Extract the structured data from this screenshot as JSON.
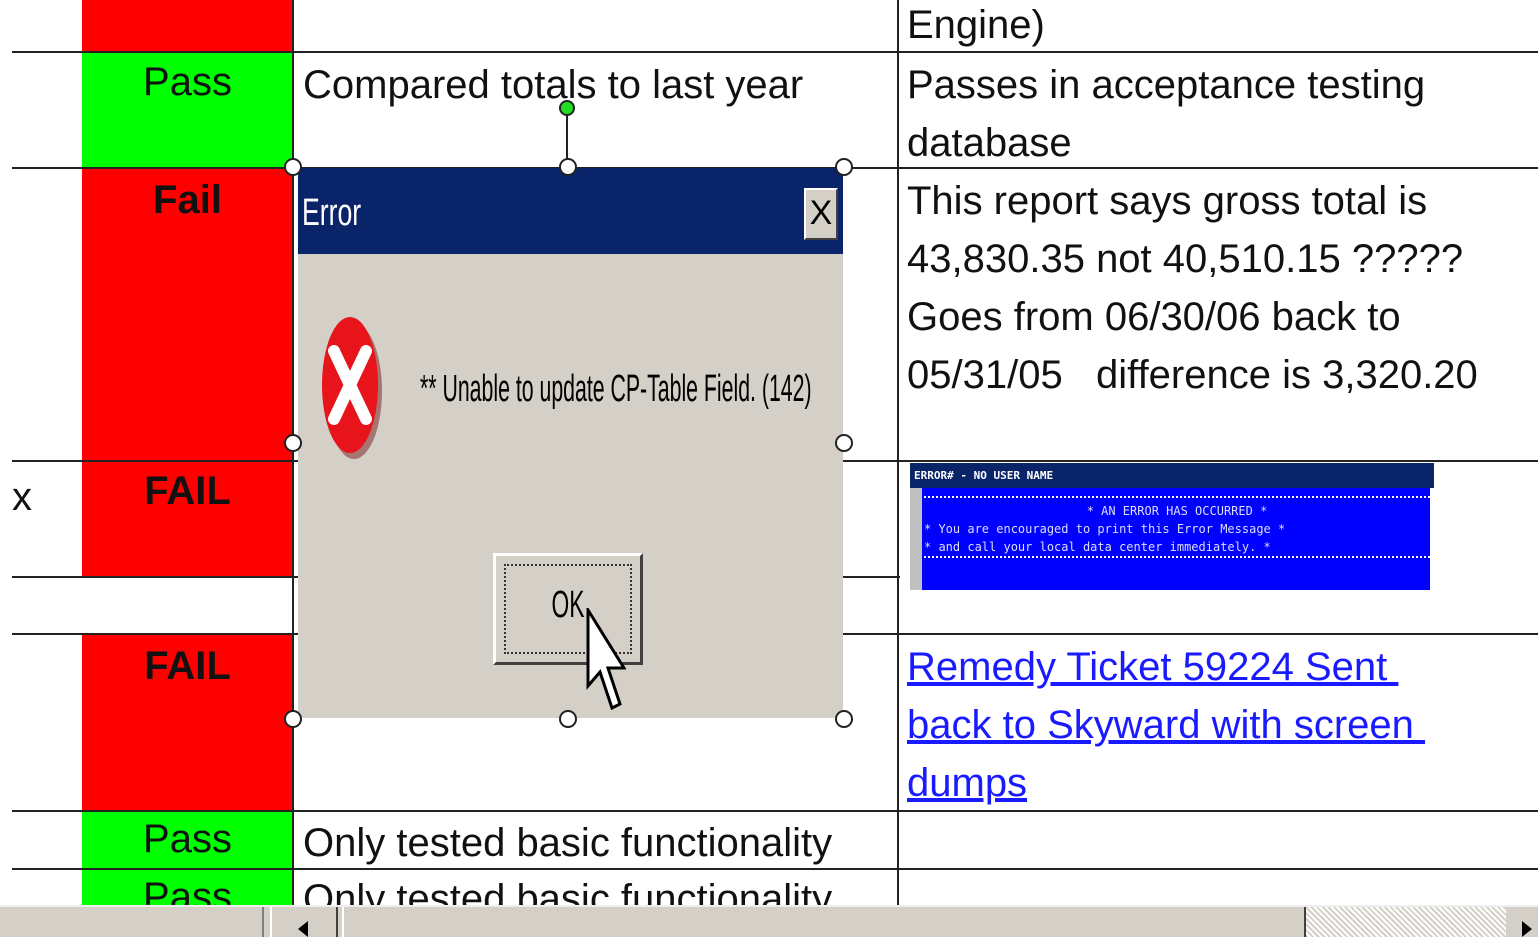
{
  "rows": {
    "r0": {
      "note": "Engine)"
    },
    "r1": {
      "status": "Pass",
      "comment": "Compared totals to last year",
      "note_lines": [
        "Passes in acceptance testing",
        "database"
      ]
    },
    "r2": {
      "status": "Fail",
      "note_lines": [
        "This report says gross total is",
        "43,830.35 not 40,510.15 ?????",
        "Goes from 06/30/06 back to",
        "05/31/05   difference is 3,320.20"
      ]
    },
    "r3": {
      "status": "FAIL",
      "left_mark": "x"
    },
    "r4": {
      "status": "FAIL",
      "note_link_lines": [
        "Remedy Ticket 59224 Sent ",
        "back to Skyward with screen ",
        "dumps"
      ]
    },
    "r5": {
      "status": "Pass",
      "comment": "Only tested basic functionality"
    },
    "r6": {
      "status": "Pass",
      "comment": "Only tested basic functionality"
    }
  },
  "dialog": {
    "title": "Error",
    "close_label": "X",
    "message": "** Unable to update CP-Table Field. (142)",
    "ok_label": "OK",
    "icon": "error-x-icon"
  },
  "error_image": {
    "header": "ERROR# - NO USER NAME",
    "lines": [
      "* AN ERROR HAS OCCURRED *",
      "* You are encouraged to print this Error Message *",
      "* and call your local data center immediately. *"
    ]
  },
  "colors": {
    "pass": "#00ff00",
    "fail": "#ff0000",
    "title_bar": "#0a246a",
    "dialog_bg": "#d4d0c8"
  }
}
